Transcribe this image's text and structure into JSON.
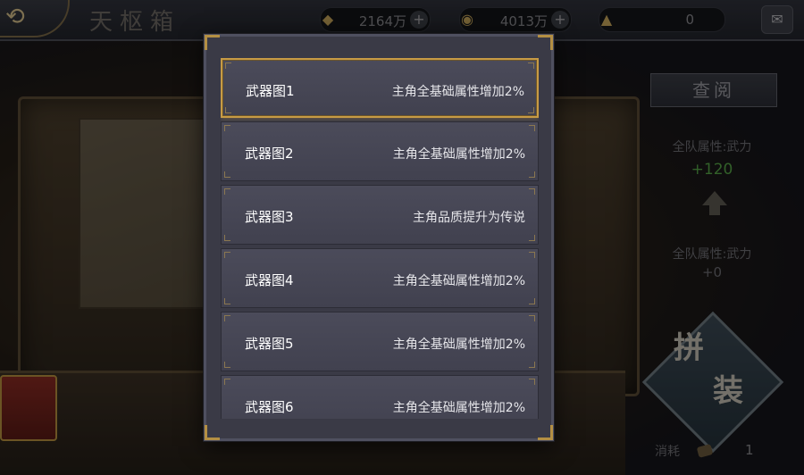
{
  "header": {
    "back_icon": "back-arrow-icon",
    "title": "天枢箱",
    "resources": [
      {
        "icon": "gold-ingot-icon",
        "value": "2164万",
        "has_plus": true
      },
      {
        "icon": "coin-icon",
        "value": "4013万",
        "has_plus": true
      },
      {
        "icon": "ore-icon",
        "value": "0",
        "has_plus": false
      }
    ],
    "chat_icon": "chat-icon"
  },
  "modal": {
    "items": [
      {
        "name": "武器图1",
        "effect": "主角全基础属性增加2%",
        "selected": true
      },
      {
        "name": "武器图2",
        "effect": "主角全基础属性增加2%",
        "selected": false
      },
      {
        "name": "武器图3",
        "effect": "主角品质提升为传说",
        "selected": false
      },
      {
        "name": "武器图4",
        "effect": "主角全基础属性增加2%",
        "selected": false
      },
      {
        "name": "武器图5",
        "effect": "主角全基础属性增加2%",
        "selected": false
      },
      {
        "name": "武器图6",
        "effect": "主角全基础属性增加2%",
        "selected": false
      }
    ]
  },
  "side": {
    "view_button": "查阅",
    "stat_current_label": "全队属性:武力",
    "stat_current_value": "+120",
    "stat_next_label": "全队属性:武力",
    "stat_next_value": "+0",
    "assemble_char1": "拼",
    "assemble_char2": "装",
    "consume_label": "消耗",
    "consume_count": "1"
  },
  "colors": {
    "accent_gold": "#c79b45",
    "stat_green": "#56a548",
    "modal_bg": "#3a3a46"
  }
}
